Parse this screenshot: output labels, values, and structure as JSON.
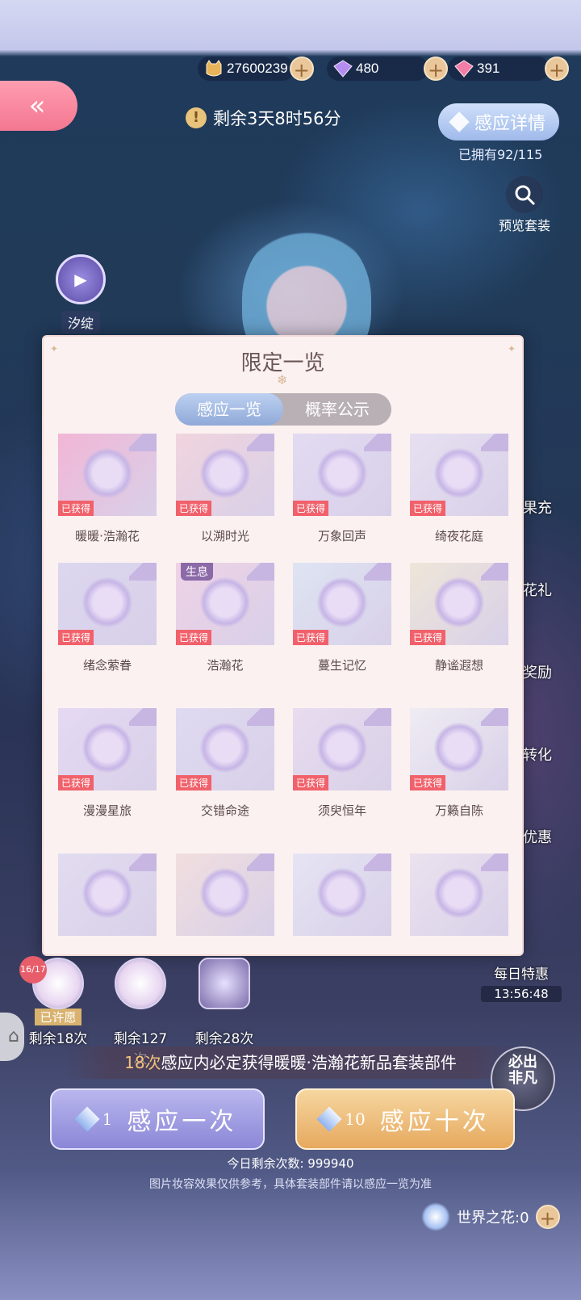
{
  "currencies": [
    {
      "icon": "cat-coin-icon",
      "value": "27600239"
    },
    {
      "icon": "purple-diamond-icon",
      "value": "480"
    },
    {
      "icon": "pink-diamond-icon",
      "value": "391"
    }
  ],
  "header": {
    "timer": "剩余3天8时56分",
    "detail_button": "感应详情",
    "owned": "已拥有92/115",
    "preview": "预览套装"
  },
  "character_button": {
    "name": "汐绽"
  },
  "side_menu": [
    "果充",
    "花礼",
    "奖励",
    "转化",
    "优惠"
  ],
  "panel": {
    "title": "限定一览",
    "tabs": [
      "感应一览",
      "概率公示"
    ],
    "items": [
      {
        "name": "暖暖·浩瀚花",
        "status": "已获得",
        "tag": "",
        "color": "#f2b6d6"
      },
      {
        "name": "以溯时光",
        "status": "已获得",
        "tag": "",
        "color": "#f1d4de"
      },
      {
        "name": "万象回声",
        "status": "已获得",
        "tag": "",
        "color": "#e3dbf2"
      },
      {
        "name": "绮夜花庭",
        "status": "已获得",
        "tag": "",
        "color": "#e7e0f1"
      },
      {
        "name": "绪念萦眷",
        "status": "已获得",
        "tag": "",
        "color": "#dcd6ef"
      },
      {
        "name": "浩瀚花",
        "status": "已获得",
        "tag": "生息",
        "color": "#efd2e6"
      },
      {
        "name": "蔓生记忆",
        "status": "已获得",
        "tag": "",
        "color": "#dee4f3"
      },
      {
        "name": "静谧遐想",
        "status": "已获得",
        "tag": "",
        "color": "#eee6d8"
      },
      {
        "name": "漫漫星旅",
        "status": "已获得",
        "tag": "",
        "color": "#e5d9f3"
      },
      {
        "name": "交错命途",
        "status": "已获得",
        "tag": "",
        "color": "#dfdaf1"
      },
      {
        "name": "须臾恒年",
        "status": "已获得",
        "tag": "",
        "color": "#e8dcef"
      },
      {
        "name": "万籁自陈",
        "status": "已获得",
        "tag": "",
        "color": "#efecf3"
      },
      {
        "name": "",
        "status": "",
        "tag": "",
        "color": "#e2dcf0"
      },
      {
        "name": "",
        "status": "",
        "tag": "",
        "color": "#f1dede"
      },
      {
        "name": "",
        "status": "",
        "tag": "",
        "color": "#e6e4f4"
      },
      {
        "name": "",
        "status": "",
        "tag": "",
        "color": "#ebe2ef"
      }
    ]
  },
  "wishes": [
    {
      "count": "16/17",
      "got": "已许愿",
      "remain": "剩余18次"
    },
    {
      "count": "",
      "got": "",
      "remain": "剩余127次"
    },
    {
      "count": "",
      "got": "",
      "remain": "剩余28次"
    }
  ],
  "daily": {
    "label": "每日特惠",
    "time": "13:56:48"
  },
  "promise": {
    "count": "18次",
    "text": "感应内必定获得暖暖·浩瀚花新品套装部件"
  },
  "guarantee": {
    "line1": "必出",
    "line2": "非凡"
  },
  "draw_one": {
    "cost": "1",
    "label": "感应一次"
  },
  "draw_ten": {
    "cost": "10",
    "label": "感应十次"
  },
  "today_remaining": "今日剩余次数: 999940",
  "disclaimer": "图片妆容效果仅供参考，具体套装部件请以感应一览为准",
  "world_flower": "世界之花:0"
}
